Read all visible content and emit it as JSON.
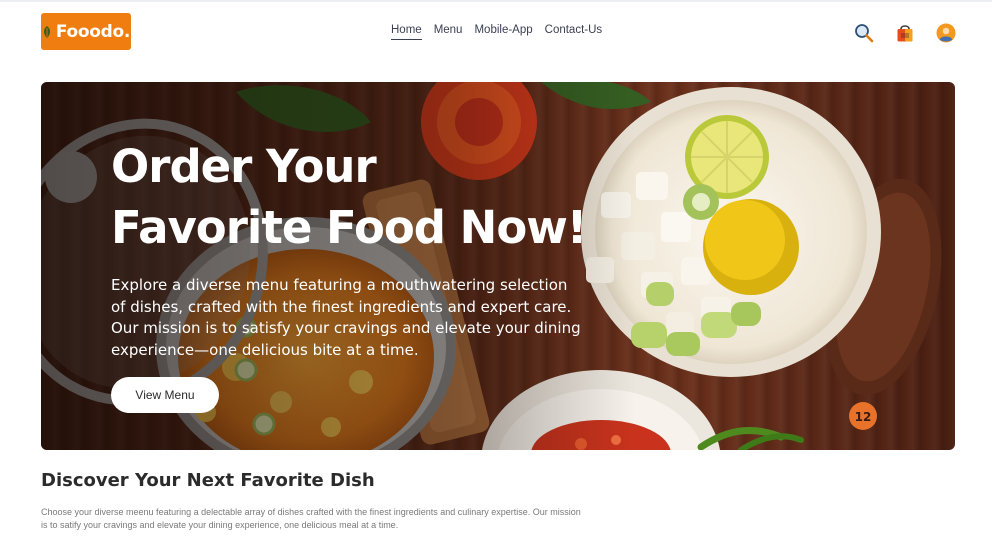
{
  "brand": {
    "name": "Fooodo.",
    "accent_color": "#f07d10"
  },
  "nav": {
    "items": [
      {
        "label": "Home",
        "active": true
      },
      {
        "label": "Menu",
        "active": false
      },
      {
        "label": "Mobile-App",
        "active": false
      },
      {
        "label": "Contact-Us",
        "active": false
      }
    ]
  },
  "header_icons": [
    "search-icon",
    "shopping-bag-icon",
    "user-avatar-icon"
  ],
  "hero": {
    "title_line1": "Order Your",
    "title_line2": "Favorite Food Now!",
    "description": "Explore a diverse menu featuring a mouthwatering selection of dishes, crafted with the finest ingredients and expert care. Our mission is to satisfy your cravings and elevate your dining experience—one delicious bite at a time.",
    "button_label": "View Menu",
    "badge_number": "12"
  },
  "discover": {
    "title": "Discover Your Next Favorite Dish",
    "text": "Choose your diverse meenu featuring a delectable array of dishes crafted with the finest ingredients and culinary expertise. Our mission is to satify your cravings and elevate your dining experience, one delicious meal at a time."
  }
}
